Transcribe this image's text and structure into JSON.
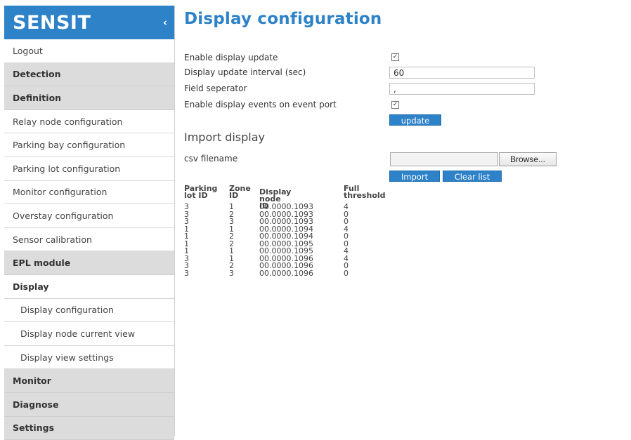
{
  "sidebar": {
    "brand": "SENSIT",
    "collapse_icon": "‹",
    "items": [
      {
        "label": "Logout",
        "type": "link"
      },
      {
        "label": "Detection",
        "type": "section"
      },
      {
        "label": "Definition",
        "type": "section"
      },
      {
        "label": "Relay node configuration",
        "type": "link"
      },
      {
        "label": "Parking bay configuration",
        "type": "link"
      },
      {
        "label": "Parking lot configuration",
        "type": "link"
      },
      {
        "label": "Monitor configuration",
        "type": "link"
      },
      {
        "label": "Overstay configuration",
        "type": "link"
      },
      {
        "label": "Sensor calibration",
        "type": "link"
      },
      {
        "label": "EPL module",
        "type": "section"
      },
      {
        "label": "Display",
        "type": "section-active"
      },
      {
        "label": "Display configuration",
        "type": "sub"
      },
      {
        "label": "Display node current view",
        "type": "sub"
      },
      {
        "label": "Display view settings",
        "type": "sub"
      },
      {
        "label": "Monitor",
        "type": "section"
      },
      {
        "label": "Diagnose",
        "type": "section"
      },
      {
        "label": "Settings",
        "type": "section"
      }
    ]
  },
  "main": {
    "title": "Display configuration",
    "form": {
      "enable_display_update_label": "Enable display update",
      "enable_display_update_checked": true,
      "update_interval_label": "Display update interval (sec)",
      "update_interval_value": "60",
      "field_separator_label": "Field seperator",
      "field_separator_value": ",",
      "enable_events_label": "Enable display events on event port",
      "enable_events_checked": true,
      "update_button": "update"
    },
    "import": {
      "title": "Import display",
      "csv_label": "csv filename",
      "browse_button": "Browse...",
      "import_button": "Import",
      "clear_button": "Clear list"
    },
    "table": {
      "headers": {
        "parking_lot_id": "Parking lot ID",
        "zone_id": "Zone ID",
        "display_node_id": "Display node ID",
        "full_threshold": "Full threshold"
      },
      "rows": [
        {
          "lot": "3",
          "zone": "1",
          "node": "00.0000.1093",
          "threshold": "4"
        },
        {
          "lot": "3",
          "zone": "2",
          "node": "00.0000.1093",
          "threshold": "0"
        },
        {
          "lot": "3",
          "zone": "3",
          "node": "00.0000.1093",
          "threshold": "0"
        },
        {
          "lot": "1",
          "zone": "1",
          "node": "00.0000.1094",
          "threshold": "4"
        },
        {
          "lot": "1",
          "zone": "2",
          "node": "00.0000.1094",
          "threshold": "0"
        },
        {
          "lot": "1",
          "zone": "2",
          "node": "00.0000.1095",
          "threshold": "0"
        },
        {
          "lot": "1",
          "zone": "1",
          "node": "00.0000.1095",
          "threshold": "4"
        },
        {
          "lot": "3",
          "zone": "1",
          "node": "00.0000.1096",
          "threshold": "4"
        },
        {
          "lot": "3",
          "zone": "2",
          "node": "00.0000.1096",
          "threshold": "0"
        },
        {
          "lot": "3",
          "zone": "3",
          "node": "00.0000.1096",
          "threshold": "0"
        }
      ]
    }
  },
  "colors": {
    "brand_blue": "#2e82c8",
    "section_gray": "#dcdcdc"
  }
}
